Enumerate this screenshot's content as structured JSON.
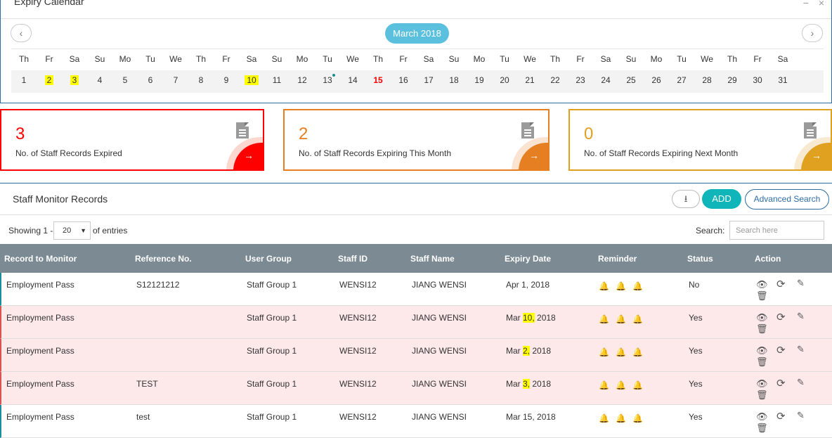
{
  "calendar": {
    "title": "Expiry Calendar",
    "minimize": "−",
    "close": "×",
    "prev": "‹",
    "next": "›",
    "month": "March 2018",
    "weekdays": [
      "Th",
      "Fr",
      "Sa",
      "Su",
      "Mo",
      "Tu",
      "We",
      "Th",
      "Fr",
      "Sa",
      "Su",
      "Mo",
      "Tu",
      "We",
      "Th",
      "Fr",
      "Sa",
      "Su",
      "Mo",
      "Tu",
      "We",
      "Th",
      "Fr",
      "Sa",
      "Su",
      "Mo",
      "Tu",
      "We",
      "Th",
      "Fr",
      "Sa"
    ],
    "dates": [
      "1",
      "2",
      "3",
      "4",
      "5",
      "6",
      "7",
      "8",
      "9",
      "10",
      "11",
      "12",
      "13",
      "14",
      "15",
      "16",
      "17",
      "18",
      "19",
      "20",
      "21",
      "22",
      "23",
      "24",
      "25",
      "26",
      "27",
      "28",
      "29",
      "30",
      "31"
    ],
    "highlighted_dates": [
      "2",
      "3",
      "10"
    ],
    "today": "15",
    "dotted_date": "13"
  },
  "cards": [
    {
      "count": "3",
      "label": "No. of Staff Records Expired",
      "color": "#ff0000",
      "arrow": "→"
    },
    {
      "count": "2",
      "label": "No. of Staff Records Expiring This Month",
      "color": "#e67e22",
      "arrow": "→"
    },
    {
      "count": "0",
      "label": "No. of Staff Records Expiring Next Month",
      "color": "#e0a020",
      "arrow": "→"
    }
  ],
  "records": {
    "title": "Staff Monitor Records",
    "download_icon": "download-icon",
    "add_label": "ADD",
    "advanced_search_label": "Advanced Search",
    "showing_label": "Showing 1 -",
    "page_size": "20",
    "entries_label": "of entries",
    "search_label": "Search:",
    "search_placeholder": "Search here",
    "columns": [
      "Record to Monitor",
      "Reference No.",
      "User Group",
      "Staff ID",
      "Staff Name",
      "Expiry Date",
      "Reminder",
      "Status",
      "Action"
    ],
    "rows": [
      {
        "record": "Employment Pass",
        "ref": "S12121212",
        "group": "Staff Group 1",
        "staff_id": "WENSI12",
        "name": "JIANG WENSI",
        "expiry_pre": "Apr 1, 2018",
        "expiry_hl": "",
        "expiry_post": "",
        "status": "No",
        "expired": false
      },
      {
        "record": "Employment Pass",
        "ref": "",
        "group": "Staff Group 1",
        "staff_id": "WENSI12",
        "name": "JIANG WENSI",
        "expiry_pre": "Mar ",
        "expiry_hl": "10,",
        "expiry_post": " 2018",
        "status": "Yes",
        "expired": true
      },
      {
        "record": "Employment Pass",
        "ref": "",
        "group": "Staff Group 1",
        "staff_id": "WENSI12",
        "name": "JIANG WENSI",
        "expiry_pre": "Mar ",
        "expiry_hl": "2,",
        "expiry_post": " 2018",
        "status": "Yes",
        "expired": true
      },
      {
        "record": "Employment Pass",
        "ref": "TEST",
        "group": "Staff Group 1",
        "staff_id": "WENSI12",
        "name": "JIANG WENSI",
        "expiry_pre": "Mar ",
        "expiry_hl": "3,",
        "expiry_post": " 2018",
        "status": "Yes",
        "expired": true
      },
      {
        "record": "Employment Pass",
        "ref": "test",
        "group": "Staff Group 1",
        "staff_id": "WENSI12",
        "name": "JIANG WENSI",
        "expiry_pre": "Mar 15, 2018",
        "expiry_hl": "",
        "expiry_post": "",
        "status": "Yes",
        "expired": false
      }
    ],
    "icons": {
      "reminder": "bell-icon",
      "view": "eye-icon",
      "renew": "refresh-icon",
      "edit": "edit-icon",
      "delete": "trash-icon"
    }
  }
}
